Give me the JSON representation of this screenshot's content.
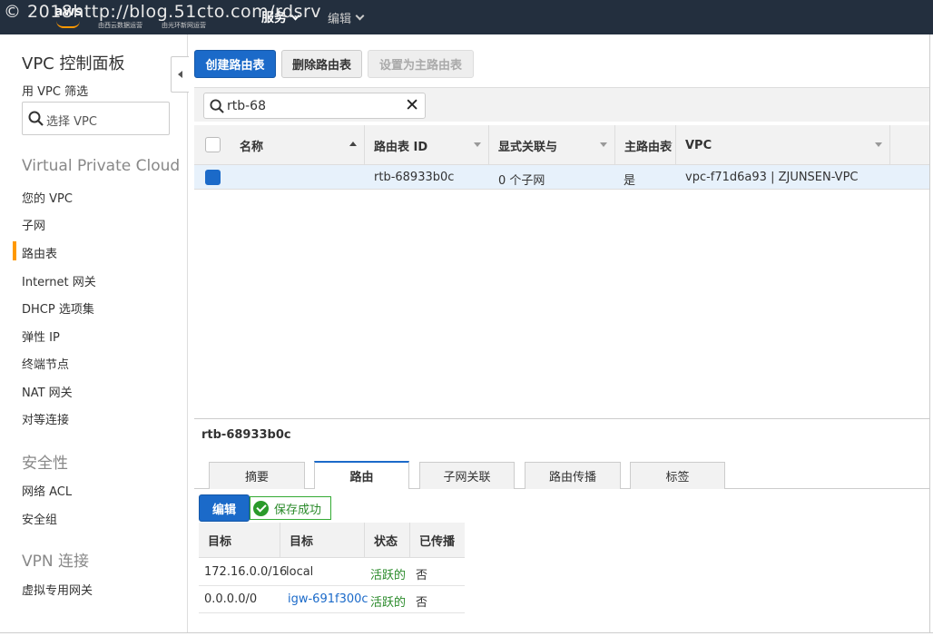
{
  "topbar": {
    "watermark": "© 2018http://blog.51cto.com/rdsrv",
    "logo_text": "aws",
    "logo_sub1": "由西云数据运营",
    "logo_sub2": "由光环新网运营",
    "services_label": "服务",
    "edit_label": "编辑"
  },
  "sidebar": {
    "title": "VPC 控制面板",
    "filter_label": "用 VPC 筛选",
    "filter_placeholder": "选择 VPC",
    "sections": [
      {
        "title": "Virtual Private Cloud"
      },
      {
        "title": "安全性"
      },
      {
        "title": "VPN 连接"
      }
    ],
    "items": [
      {
        "label": "您的 VPC"
      },
      {
        "label": "子网"
      },
      {
        "label": "路由表"
      },
      {
        "label": "Internet 网关"
      },
      {
        "label": "DHCP 选项集"
      },
      {
        "label": "弹性 IP"
      },
      {
        "label": "终端节点"
      },
      {
        "label": "NAT 网关"
      },
      {
        "label": "对等连接"
      },
      {
        "label": "网络 ACL"
      },
      {
        "label": "安全组"
      },
      {
        "label": "虚拟专用网关"
      }
    ]
  },
  "toolbar": {
    "create_label": "创建路由表",
    "delete_label": "删除路由表",
    "set_main_label": "设置为主路由表"
  },
  "search": {
    "value": "rtb-68"
  },
  "table": {
    "columns": [
      "名称",
      "路由表 ID",
      "显式关联与",
      "主路由表",
      "VPC"
    ],
    "rows": [
      {
        "name": "",
        "id": "rtb-68933b0c",
        "assoc": "0 个子网",
        "main": "是",
        "vpc": "vpc-f71d6a93 | ZJUNSEN-VPC"
      }
    ]
  },
  "detail": {
    "title": "rtb-68933b0c",
    "tabs": [
      "摘要",
      "路由",
      "子网关联",
      "路由传播",
      "标签"
    ],
    "active_tab": "路由",
    "edit_label": "编辑",
    "success_text": "保存成功",
    "routes": {
      "columns": [
        "目标",
        "目标",
        "状态",
        "已传播"
      ],
      "rows": [
        {
          "dest": "172.16.0.0/16",
          "target": "local",
          "status": "活跃的",
          "propagated": "否"
        },
        {
          "dest": "0.0.0.0/0",
          "target": "igw-691f300c",
          "status": "活跃的",
          "propagated": "否"
        }
      ]
    }
  },
  "colors": {
    "topbar": "#232f3e",
    "primary": "#1b6ac9",
    "accent": "#ff9900",
    "success": "#2a8a2a"
  }
}
